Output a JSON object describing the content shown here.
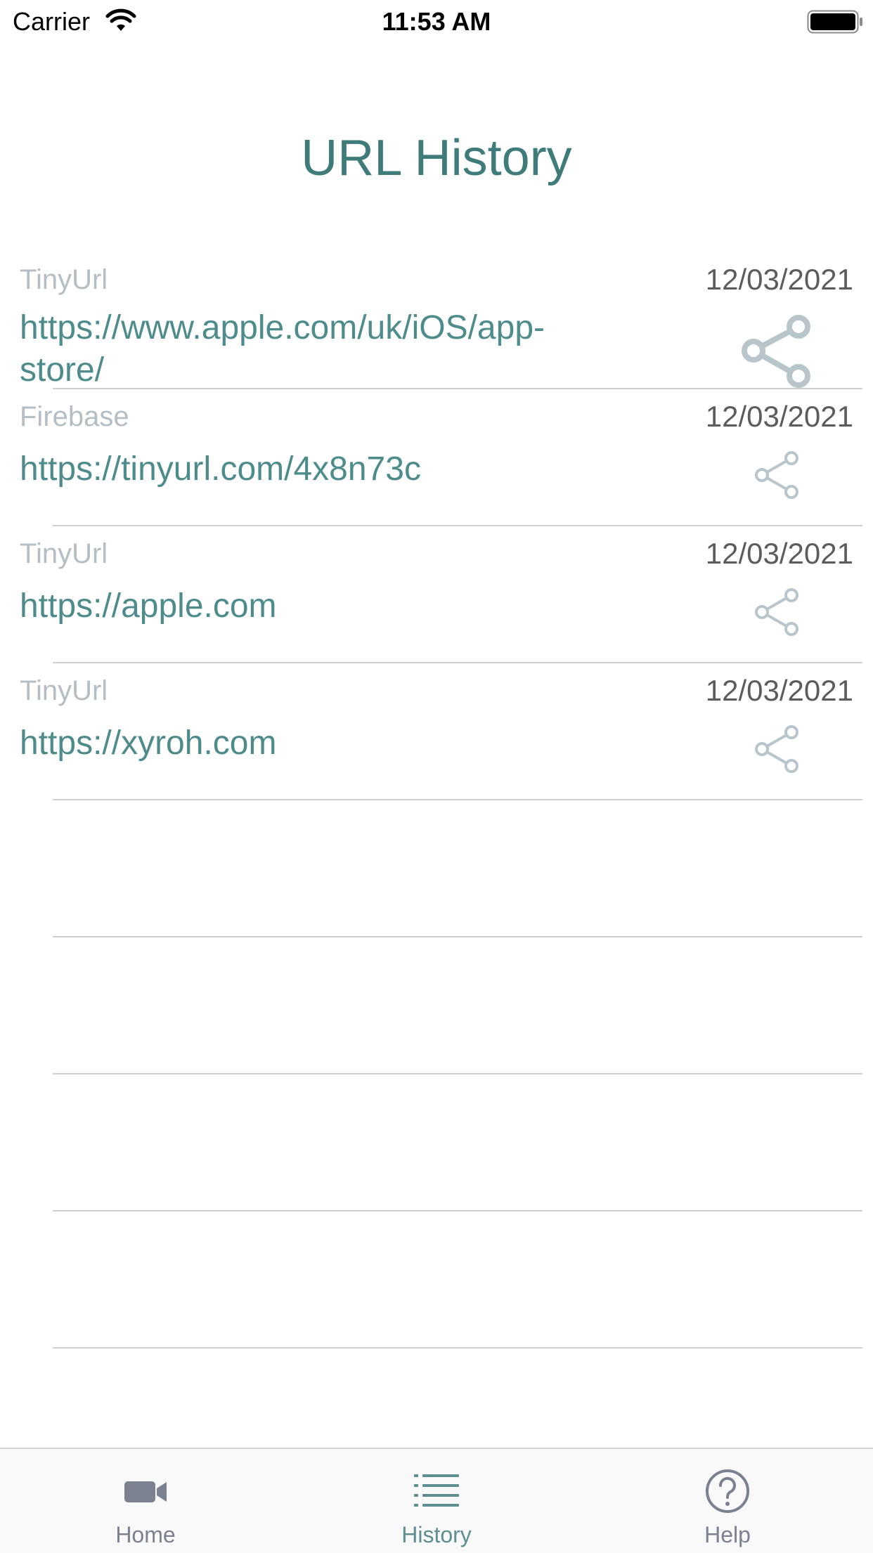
{
  "status_bar": {
    "carrier": "Carrier",
    "time": "11:53 AM",
    "icons": [
      "wifi-icon",
      "battery-icon"
    ]
  },
  "title": "URL History",
  "history": [
    {
      "source": "TinyUrl",
      "date": "12/03/2021",
      "url": "https://www.apple.com/uk/iOS/app-store/"
    },
    {
      "source": "Firebase",
      "date": "12/03/2021",
      "url": "https://tinyurl.com/4x8n73c"
    },
    {
      "source": "TinyUrl",
      "date": "12/03/2021",
      "url": "https://apple.com"
    },
    {
      "source": "TinyUrl",
      "date": "12/03/2021",
      "url": "https://xyroh.com"
    }
  ],
  "tab_bar": {
    "tabs": [
      {
        "label": "Home",
        "icon": "video-camera-icon",
        "active": false
      },
      {
        "label": "History",
        "icon": "list-icon",
        "active": true
      },
      {
        "label": "Help",
        "icon": "question-circle-icon",
        "active": false
      }
    ]
  },
  "colors": {
    "accent": "#3e7b79",
    "url": "#4d8c8a",
    "source_label": "#b5bec4",
    "share_icon": "#b8c6cc",
    "tab_inactive": "#7b8190",
    "tab_active": "#5e8e90"
  }
}
